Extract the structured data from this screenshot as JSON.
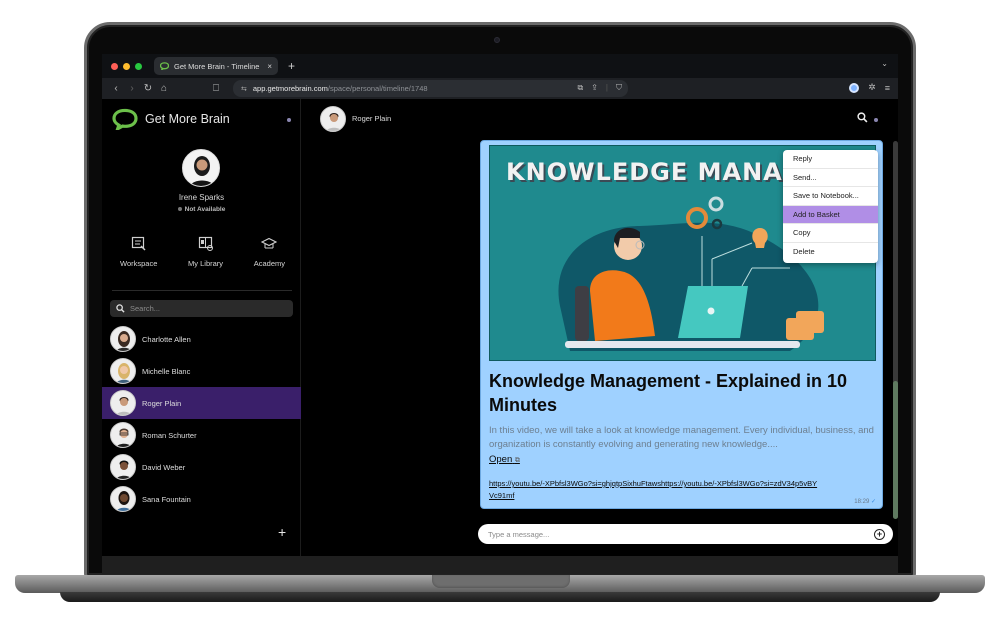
{
  "browser": {
    "tab_title": "Get More Brain - Timeline",
    "tab_close": "×",
    "new_tab": "+",
    "url_host": "app.getmorebrain.com",
    "url_path": "/space/personal/timeline/1748",
    "traffic_colors": [
      "#ff5f57",
      "#febc2e",
      "#28c840"
    ]
  },
  "brand": {
    "name": "Get More Brain",
    "logo_color": "#6cc04a"
  },
  "profile": {
    "name": "Irene Sparks",
    "status": "Not Available"
  },
  "quicklinks": [
    {
      "label": "Workspace",
      "icon": "workspace-icon"
    },
    {
      "label": "My Library",
      "icon": "library-icon"
    },
    {
      "label": "Academy",
      "icon": "graduation-cap-icon"
    }
  ],
  "search": {
    "placeholder": "Search..."
  },
  "contacts": [
    {
      "name": "Charlotte Allen",
      "active": false
    },
    {
      "name": "Michelle Blanc",
      "active": false
    },
    {
      "name": "Roger Plain",
      "active": true
    },
    {
      "name": "Roman Schurter",
      "active": false
    },
    {
      "name": "David Weber",
      "active": false
    },
    {
      "name": "Sana Fountain",
      "active": false
    }
  ],
  "chat": {
    "contact_name": "Roger Plain",
    "message": {
      "thumbnail_title": "KNOWLEDGE MANAGEMENT",
      "title": "Knowledge Management - Explained in 10 Minutes",
      "description": "In this video, we will take a look at knowledge management. Every individual, business, and organization is constantly evolving and generating new knowledge....",
      "open_label": "Open",
      "link": "https://youtu.be/-XPbfsl3WGo?si=ghjqtpSixhuFtawshttps://youtu.be/-XPbfsl3WGo?si=zdV34p5vBYVc91mf",
      "time": "18:29",
      "read_mark": "✓"
    },
    "context_menu": [
      {
        "label": "Reply",
        "highlighted": false
      },
      {
        "label": "Send...",
        "highlighted": false
      },
      {
        "label": "Save to Notebook...",
        "highlighted": false
      },
      {
        "label": "Add to Basket",
        "highlighted": true
      },
      {
        "label": "Copy",
        "highlighted": false
      },
      {
        "label": "Delete",
        "highlighted": false
      }
    ],
    "composer_placeholder": "Type a message..."
  },
  "colors": {
    "active_contact": "#3a1f6a",
    "bubble": "#9fd1ff",
    "menu_highlight": "#b08ee6"
  }
}
